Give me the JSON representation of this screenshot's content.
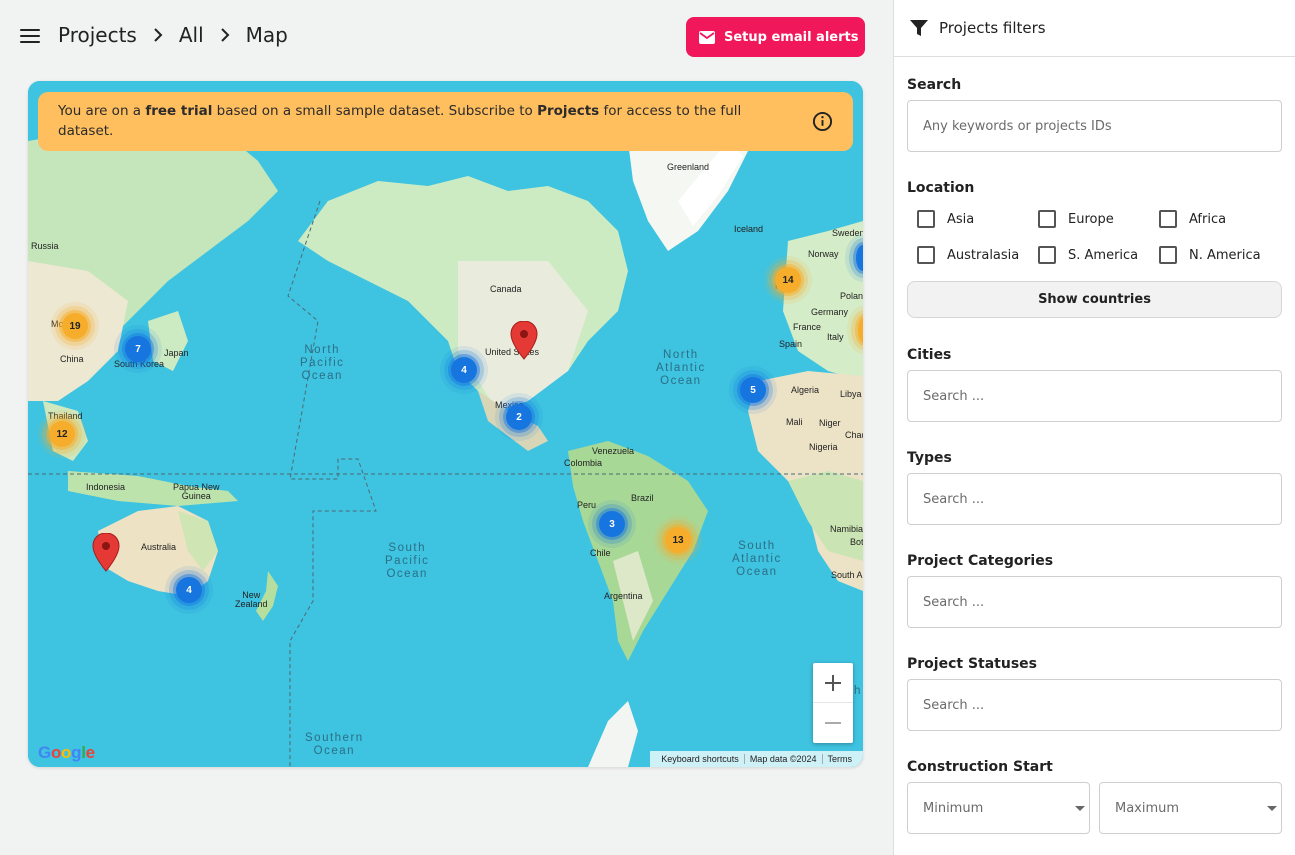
{
  "header": {
    "breadcrumb": [
      "Projects",
      "All",
      "Map"
    ],
    "email_alerts_label": "Setup email alerts"
  },
  "trial_banner": {
    "part1": "You are on a ",
    "bold1": "free trial",
    "part2": " based on a small sample dataset. Subscribe to ",
    "bold2": "Projects",
    "part3": " for access to the full dataset."
  },
  "map": {
    "countries": {
      "russia": "Russia",
      "mongolia": "Mo",
      "china": "China",
      "japan": "Japan",
      "south_korea": "South Korea",
      "thailand": "Thailand",
      "indonesia": "Indonesia",
      "png": "Papua New\nGuinea",
      "australia": "Australia",
      "new_zealand": "New\nZealand",
      "greenland": "Greenland",
      "iceland": "Iceland",
      "canada": "Canada",
      "usa": "United States",
      "mexico": "Mexico",
      "venezuela": "Venezuela",
      "colombia": "Colombia",
      "brazil": "Brazil",
      "peru": "Peru",
      "chile": "Chile",
      "argentina": "Argentina",
      "sweden": "Sweden",
      "norway": "Norway",
      "poland": "Polan",
      "germany": "Germany",
      "france": "France",
      "spain": "Spain",
      "italy": "Italy",
      "uk": "Ki",
      "algeria": "Algeria",
      "libya": "Libya",
      "mali": "Mali",
      "niger": "Niger",
      "chad": "Chad",
      "nigeria": "Nigeria",
      "namibia": "Namibia",
      "botswana": "Bot",
      "south_africa": "South A"
    },
    "oceans": {
      "north_pacific": "North\nPacific\nOcean",
      "north_atlantic": "North\nAtlantic\nOcean",
      "south_pacific": "South\nPacific\nOcean",
      "south_atlantic": "South\nAtlantic\nOcean",
      "southern": "Southern\nOcean",
      "indian_partial": "h"
    },
    "clusters": [
      {
        "count": "19",
        "color": "orange"
      },
      {
        "count": "7",
        "color": "blue"
      },
      {
        "count": "12",
        "color": "orange"
      },
      {
        "count": "4",
        "color": "blue"
      },
      {
        "count": "4",
        "color": "blue"
      },
      {
        "count": "2",
        "color": "blue"
      },
      {
        "count": "3",
        "color": "blue"
      },
      {
        "count": "13",
        "color": "orange"
      },
      {
        "count": "5",
        "color": "blue"
      },
      {
        "count": "14",
        "color": "orange"
      }
    ],
    "google_logo": "Google",
    "attribution": {
      "shortcuts": "Keyboard shortcuts",
      "map_data": "Map data ©2024",
      "terms": "Terms"
    }
  },
  "filters": {
    "title": "Projects filters",
    "search": {
      "label": "Search",
      "placeholder": "Any keywords or projects IDs"
    },
    "location": {
      "label": "Location",
      "options": [
        "Asia",
        "Europe",
        "Africa",
        "Australasia",
        "S. America",
        "N. America"
      ],
      "show_countries": "Show countries"
    },
    "cities": {
      "label": "Cities",
      "placeholder": "Search ..."
    },
    "types": {
      "label": "Types",
      "placeholder": "Search ..."
    },
    "categories": {
      "label": "Project Categories",
      "placeholder": "Search ..."
    },
    "statuses": {
      "label": "Project Statuses",
      "placeholder": "Search ..."
    },
    "construction_start": {
      "label": "Construction Start",
      "min": "Minimum",
      "max": "Maximum"
    }
  },
  "colors": {
    "brand": "#f0185a",
    "banner": "#ffbf5e",
    "ocean": "#3ec3e0",
    "land": "#cdebc3",
    "cluster_blue": "#1775e0",
    "cluster_orange": "#f6ad2b",
    "pin": "#e53935"
  }
}
